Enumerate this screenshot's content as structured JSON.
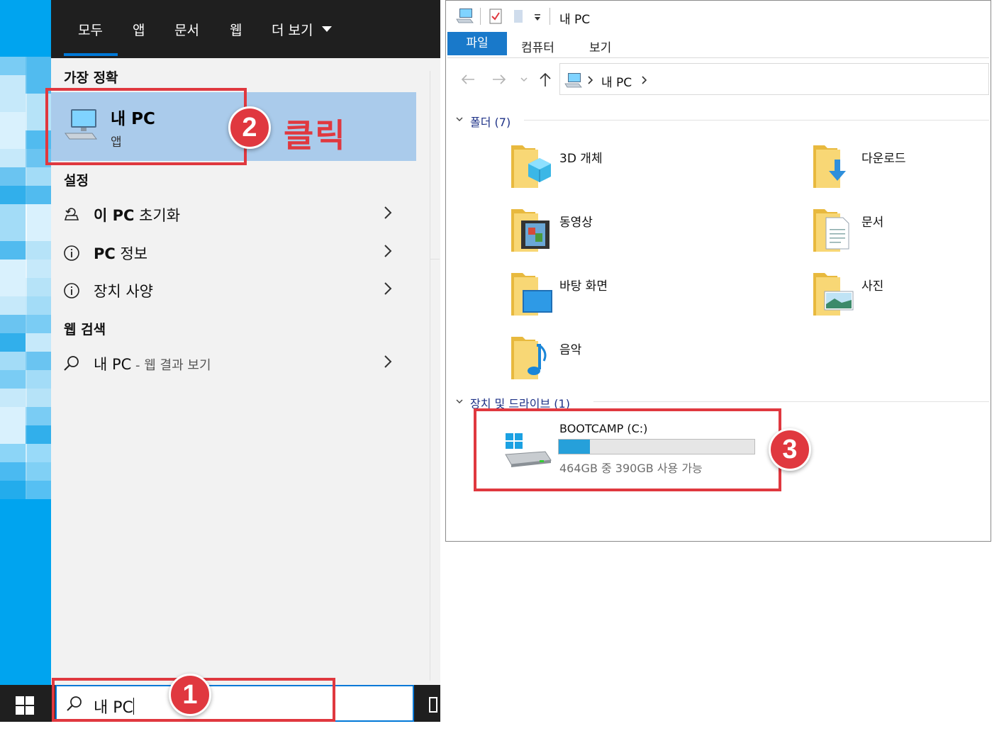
{
  "start_menu": {
    "tabs": [
      "모두",
      "앱",
      "문서",
      "웹",
      "더 보기"
    ],
    "best_match": {
      "heading": "가장 정확",
      "title": "내 PC",
      "subtitle": "앱"
    },
    "settings": {
      "heading": "설정",
      "items": [
        {
          "bold": "이 PC",
          "rest": " 초기화",
          "icon": "reset-icon"
        },
        {
          "bold": "PC",
          "rest": " 정보",
          "icon": "info-icon"
        },
        {
          "bold": "",
          "rest": "장치 사양",
          "icon": "info-icon"
        }
      ]
    },
    "web": {
      "heading": "웹 검색",
      "query": "내 PC",
      "suffix": " - 웹 결과 보기"
    },
    "search": {
      "value": "내 PC"
    }
  },
  "annotations": {
    "step1": "1",
    "step2": "2",
    "step3": "3",
    "click_label": "클릭"
  },
  "explorer": {
    "title": "내 PC",
    "ribbon": {
      "file": "파일",
      "tabs": [
        "컴퓨터",
        "보기"
      ]
    },
    "address": "내 PC",
    "folders_group": "폴더 (7)",
    "folders": [
      "3D 개체",
      "다운로드",
      "동영상",
      "문서",
      "바탕 화면",
      "사진",
      "음악"
    ],
    "devices_group": "장치 및 드라이브 (1)",
    "drive": {
      "name": "BOOTCAMP (C:)",
      "free_text": "464GB 중 390GB 사용 가능",
      "used_fraction": 0.16
    }
  },
  "colors": {
    "accent": "#0078d7",
    "highlight": "#aacbeb",
    "callout": "#e0383f",
    "drive_bar": "#26a0da"
  }
}
